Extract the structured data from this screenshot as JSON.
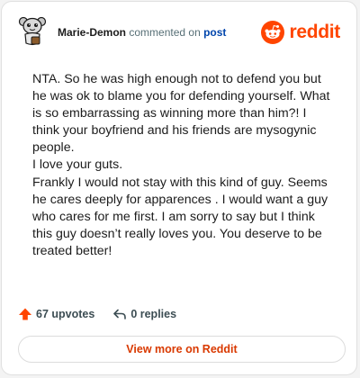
{
  "header": {
    "username": "Marie-Demon",
    "action_text": "commented on",
    "post_link": "post",
    "brand": "reddit"
  },
  "comment": {
    "paragraphs": [
      "NTA. So he was high enough not to defend you but he was ok to blame you for defending yourself. What is so embarrassing as winning more than him?! I think your boyfriend and his friends are mysogynic people.",
      "I love your guts.",
      "Frankly I would not stay with this kind of guy. Seems he cares deeply for apparences . I would want a guy who cares for me first. I am sorry to say but I think this guy doesn’t really loves you. You deserve to be treated better!"
    ]
  },
  "actions": {
    "upvotes": "67 upvotes",
    "replies": "0 replies"
  },
  "footer": {
    "view_more": "View more on Reddit"
  },
  "icons": {
    "avatar": "snoo-avatar-icon",
    "brand": "reddit-logo-icon",
    "upvote": "upvote-arrow-icon",
    "reply": "reply-arrow-icon"
  },
  "colors": {
    "brand": "#ff4500",
    "link": "#0045ac",
    "view_more": "#d93900"
  }
}
